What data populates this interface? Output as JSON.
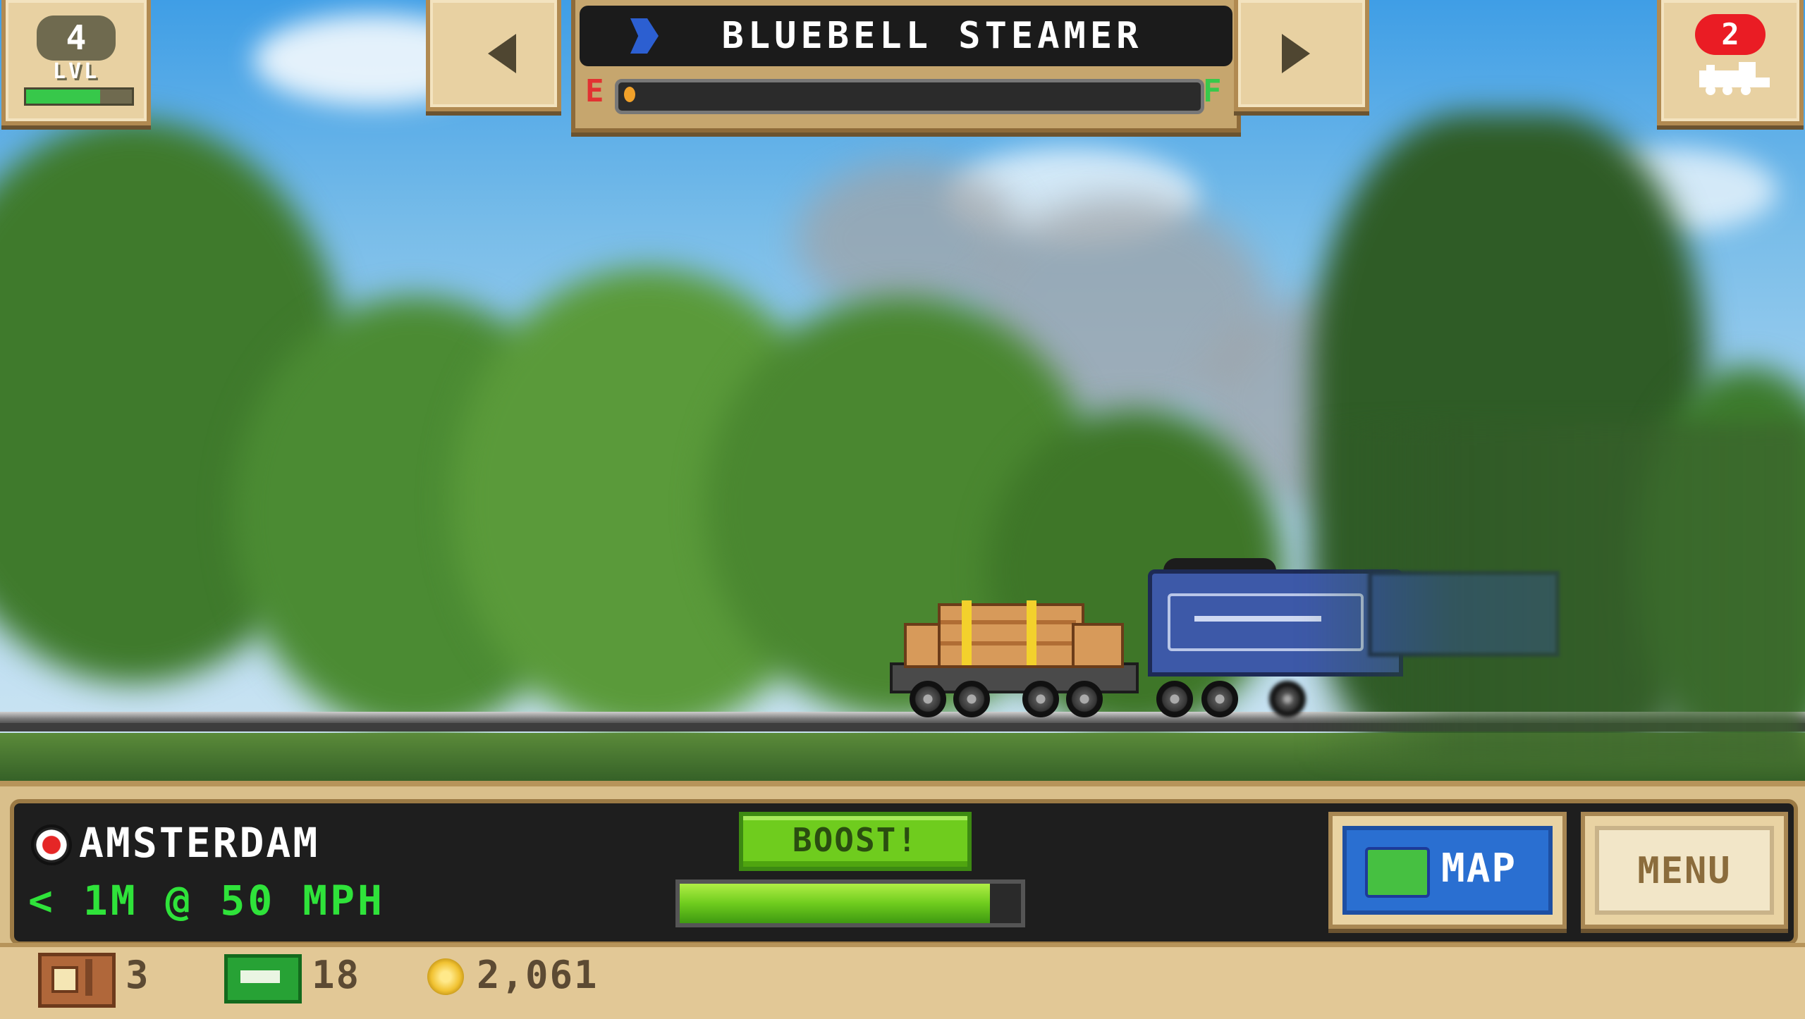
{
  "level": {
    "number": "4",
    "label": "LVL",
    "xp_progress": 0.7
  },
  "train": {
    "name": "BLUEBELL STEAMER",
    "fuel_empty_label": "E",
    "fuel_full_label": "F",
    "fuel_level": 0.01
  },
  "orders": {
    "count": "2"
  },
  "destination": {
    "name": "AMSTERDAM",
    "eta": "< 1M @ 50 MPH"
  },
  "boost": {
    "label": "BOOST!",
    "charge": 0.91
  },
  "buttons": {
    "map": "MAP",
    "menu": "MENU"
  },
  "resources": {
    "crates": "3",
    "cash": "18",
    "coins": "2,061"
  },
  "icons": [
    "bluebell-locomotive-icon",
    "orders-train-icon",
    "map-icon",
    "destination-marker-icon",
    "crate-icon",
    "cash-icon",
    "coin-icon"
  ],
  "colors": {
    "xp_bar": "#37c84a",
    "fuel_empty": "#e23232",
    "fuel_full": "#38c94b",
    "eta_text": "#2fe33a",
    "boost": "#6fcc1e",
    "orders_badge": "#ea1c24"
  }
}
